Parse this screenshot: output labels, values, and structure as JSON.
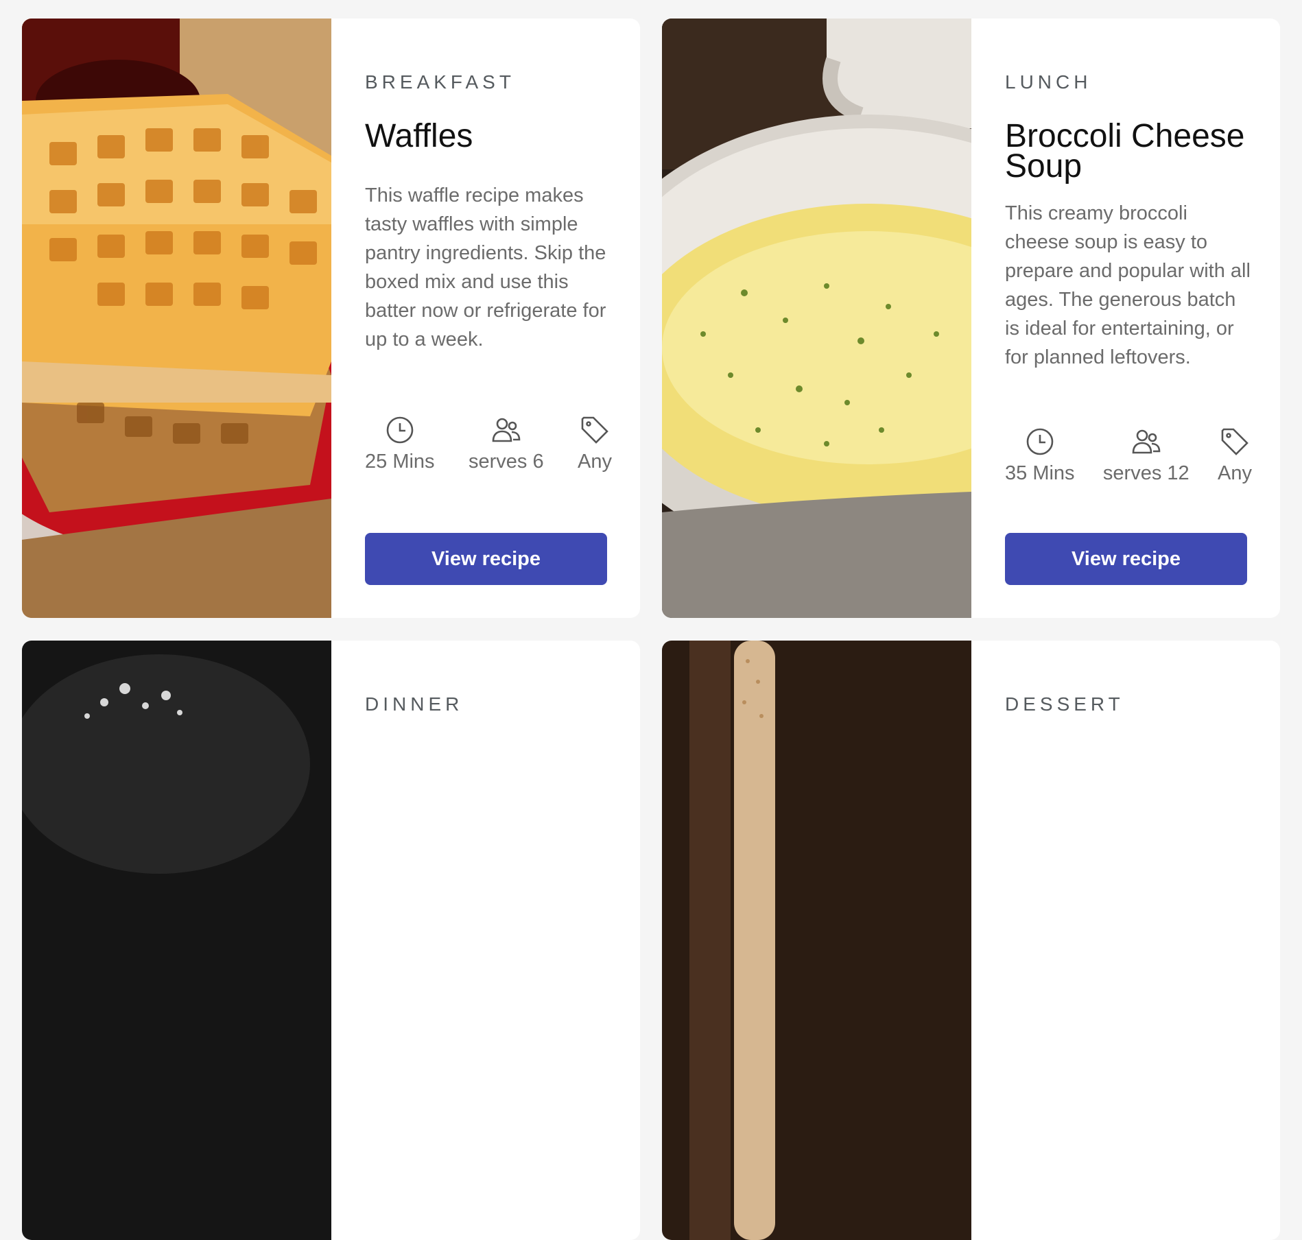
{
  "cards": [
    {
      "category": "BREAKFAST",
      "title": "Waffles",
      "description": "This waffle recipe makes tasty waffles with simple pantry ingredients. Skip the boxed mix and use this batter now or refrigerate for up to a week.",
      "time": "25 Mins",
      "serves": "serves 6",
      "tag": "Any",
      "button_label": "View recipe",
      "image": "waffles-photo"
    },
    {
      "category": "LUNCH",
      "title": "Broccoli Cheese Soup",
      "description": "This creamy broccoli cheese soup is easy to prepare and popular with all ages. The generous batch is ideal for entertaining, or for planned leftovers.",
      "time": "35 Mins",
      "serves": "serves 12",
      "tag": "Any",
      "button_label": "View recipe",
      "image": "soup-photo"
    },
    {
      "category": "DINNER",
      "image": "pan-photo"
    },
    {
      "category": "DESSERT",
      "image": "breadstick-photo"
    }
  ],
  "colors": {
    "background": "#f5f5f5",
    "card": "#ffffff",
    "button": "#3f4ab2",
    "button_text": "#ffffff",
    "category_text": "#555a5e",
    "body_text": "#6b6b6b"
  },
  "icons": [
    "clock-icon",
    "users-icon",
    "tag-icon"
  ]
}
